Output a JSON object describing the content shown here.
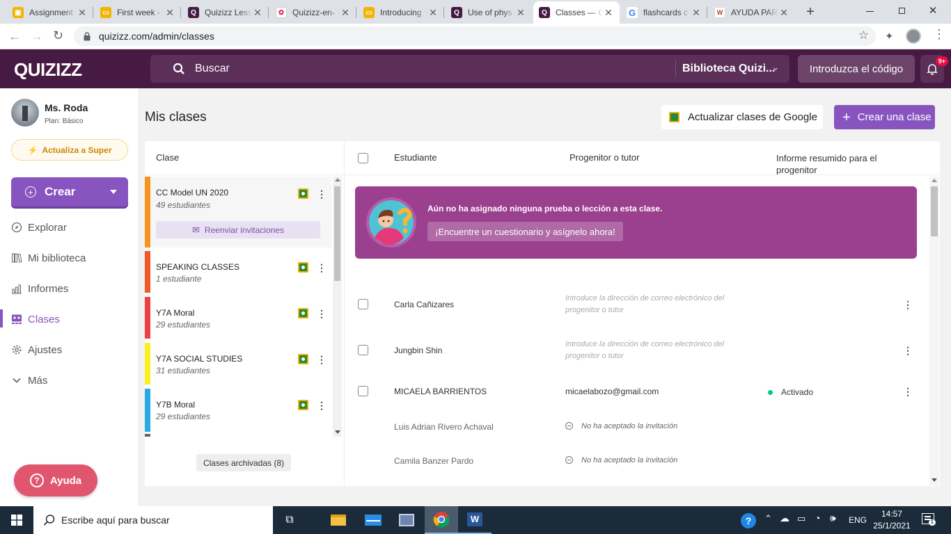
{
  "browser": {
    "tabs": [
      {
        "title": "Assignment",
        "color": "#f4b400",
        "glyph": "classroom"
      },
      {
        "title": "First week -",
        "color": "#f4b400",
        "glyph": "slides"
      },
      {
        "title": "Quizizz Less",
        "color": "#461a42",
        "glyph": "Q"
      },
      {
        "title": "Quizizz-en-",
        "color": "#e8eaed",
        "glyph": "flower"
      },
      {
        "title": "Introducing",
        "color": "#f4b400",
        "glyph": "slides"
      },
      {
        "title": "Use of phys",
        "color": "#461a42",
        "glyph": "Q"
      },
      {
        "title": "Classes — Q",
        "color": "#461a42",
        "glyph": "Q"
      },
      {
        "title": "flashcards c",
        "color": "#ffffff",
        "glyph": "G"
      },
      {
        "title": "AYUDA PAR",
        "color": "#ffffff",
        "glyph": "W"
      }
    ],
    "url": "quizizz.com/admin/classes"
  },
  "header": {
    "logo": "QUIZIZZ",
    "search_placeholder": "Buscar",
    "library_select": "Biblioteca Quizi...",
    "code_button": "Introduzca el código",
    "notif_badge": "9+"
  },
  "sidebar": {
    "user_name": "Ms. Roda",
    "plan": "Plan: Básico",
    "upgrade": "Actualiza a Super",
    "create": "Crear",
    "nav": [
      {
        "label": "Explorar",
        "icon": "compass-icon"
      },
      {
        "label": "Mi biblioteca",
        "icon": "library-icon"
      },
      {
        "label": "Informes",
        "icon": "reports-icon"
      },
      {
        "label": "Clases",
        "icon": "classes-icon",
        "active": true
      },
      {
        "label": "Ajustes",
        "icon": "gear-icon"
      },
      {
        "label": "Más",
        "icon": "chevron-down-icon"
      }
    ],
    "help": "Ayuda"
  },
  "main": {
    "title": "Mis clases",
    "google_button": "Actualizar clases de Google",
    "create_class_button": "Crear una clase",
    "columns": {
      "class": "Clase",
      "student": "Estudiante",
      "parent": "Progenitor o tutor",
      "report": "Informe resumido para el progenitor"
    },
    "classes": [
      {
        "name": "CC Model UN 2020",
        "count": "49 estudiantes",
        "color": "#f7941d",
        "selected": true,
        "resend": "Reenviar invitaciones"
      },
      {
        "name": "SPEAKING CLASSES",
        "count": "1 estudiante",
        "color": "#f15a24"
      },
      {
        "name": "Y7A Moral",
        "count": "29 estudiantes",
        "color": "#ed4040"
      },
      {
        "name": "Y7A SOCIAL STUDIES",
        "count": "31 estudiantes",
        "color": "#fcee21"
      },
      {
        "name": "Y7B Moral",
        "count": "29 estudiantes",
        "color": "#29abe2"
      }
    ],
    "archived": "Clases archivadas (8)",
    "banner": {
      "text": "Aún no ha asignado ninguna prueba o lección a esta clase.",
      "button": "¡Encuentre un cuestionario y asígnelo ahora!"
    },
    "students": [
      {
        "name": "Carla Cañizares",
        "parent_placeholder": "Introduce la dirección de correo electrónico del progenitor o tutor"
      },
      {
        "name": "Jungbin Shin",
        "parent_placeholder": "Introduce la dirección de correo electrónico del progenitor o tutor"
      },
      {
        "name": "MICAELA BARRIENTOS",
        "parent": "micaelabozo@gmail.com",
        "status": "Activado",
        "status_color": "#00c985"
      },
      {
        "name": "Luis Adrian Rivero Achaval",
        "pending": "No ha aceptado la invitación"
      },
      {
        "name": "Camila Banzer Pardo",
        "pending": "No ha aceptado la invitación"
      }
    ]
  },
  "taskbar": {
    "search_placeholder": "Escribe aquí para buscar",
    "lang": "ENG",
    "time": "14:57",
    "date": "25/1/2021"
  },
  "colors": {
    "accent": "#8854c0",
    "header": "#461a42",
    "banner": "#9b3f8f"
  }
}
